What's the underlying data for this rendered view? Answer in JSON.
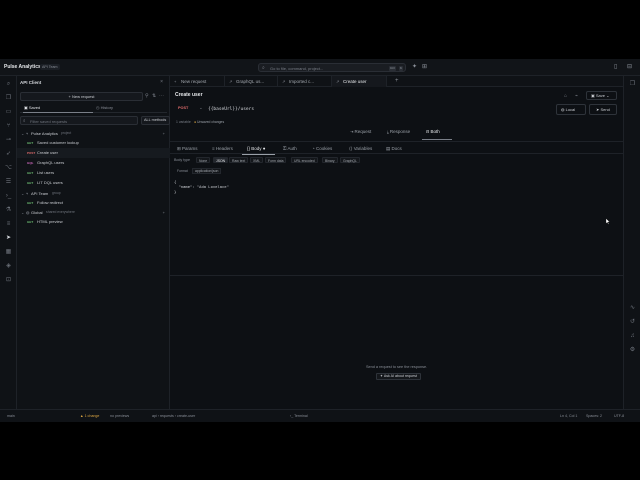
{
  "app": {
    "name": "Pulse Analytics",
    "badge": "API Team"
  },
  "command_bar": {
    "placeholder": "Go to file, command, project...",
    "kbd1": "Ctrl",
    "kbd2": "K"
  },
  "sidebar": {
    "title": "API Client",
    "new_request": "New request",
    "tabs": {
      "saved": "Saved",
      "history": "History"
    },
    "filter_placeholder": "Filter saved requests",
    "method_filter": "ALL methods",
    "tree": {
      "pulse": {
        "name": "Pulse Analytics",
        "tag": "project"
      },
      "api_team": {
        "name": "API Team",
        "tag": "group"
      },
      "global": {
        "name": "Global",
        "tag": "shared everywhere"
      }
    },
    "requests": [
      {
        "method": "GET",
        "name": "Saved customer lookup",
        "color": "#6fbf73"
      },
      {
        "method": "POST",
        "name": "Create user",
        "color": "#e06c6c"
      },
      {
        "method": "GQL",
        "name": "GraphQL users",
        "color": "#d36ac2"
      },
      {
        "method": "GET",
        "name": "List users",
        "color": "#6fbf73"
      },
      {
        "method": "GET",
        "name": "LIT DQL users",
        "color": "#6fbf73"
      }
    ],
    "api_team_requests": [
      {
        "method": "GET",
        "name": "Follow redirect",
        "color": "#6fbf73"
      }
    ],
    "global_requests": [
      {
        "method": "GET",
        "name": "HTML preview",
        "color": "#6fbf73"
      }
    ]
  },
  "tabs": [
    {
      "label": "New request",
      "icon": "+"
    },
    {
      "label": "GraphQL us...",
      "icon": "↗"
    },
    {
      "label": "Imported c...",
      "icon": "↗"
    },
    {
      "label": "Create user",
      "icon": "↗"
    }
  ],
  "request": {
    "title": "Create user",
    "save_label": "Save",
    "method": "POST",
    "url": "{{baseUrl}}/users",
    "env": "Local",
    "send": "Send",
    "meta_vars": "1 variable",
    "meta_changes": "Unsaved changes"
  },
  "segments": {
    "request": "Request",
    "response": "Response",
    "both": "Both"
  },
  "subtabs": {
    "params": "Params",
    "headers": "Headers",
    "body": "Body",
    "auth": "Auth",
    "cookies": "Cookies",
    "variables": "Variables",
    "docs": "Docs"
  },
  "body": {
    "label": "Body type",
    "types": [
      "None",
      "JSON",
      "Raw text",
      "XML",
      "Form data",
      "URL encoded",
      "Binary",
      "GraphQL"
    ],
    "active": "JSON",
    "ctype_label": "Format",
    "ctype_value": "application/json",
    "code_open": "{",
    "code_key": "\"name\"",
    "code_val": "\"Ada Lovelace\"",
    "code_close": "}"
  },
  "response": {
    "empty": "Send a request to see the response.",
    "ask": "Ask AI about request"
  },
  "status": {
    "mode": "main",
    "changes": "1 change",
    "preview": "no previews",
    "path": "api › requests › create-user",
    "terminal": "Terminal",
    "encoding": "UTF-8",
    "lines": "Ln 4, Col 1",
    "tabsize": "Spaces: 2"
  },
  "colors": {
    "accent": "#e06c6c",
    "warn": "#d9a441",
    "bg": "#0d1014"
  }
}
